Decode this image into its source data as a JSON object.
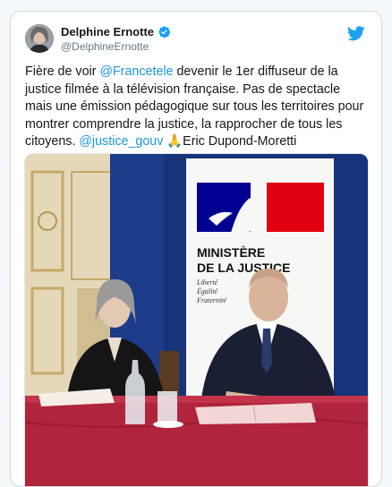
{
  "author": {
    "name": "Delphine Ernotte",
    "handle": "@DelphineErnotte",
    "verified": true
  },
  "tweet": {
    "t1": "Fière de voir ",
    "m1": "@Francetele",
    "t2": " devenir le 1er diffuseur de la justice filmée à la télévision française. Pas de spectacle mais une émission pédagogique sur tous les territoires pour montrer comprendre la justice, la rapprocher de tous les citoyens. ",
    "m2": "@justice_gouv",
    "t3": " 🙏Eric Dupond-Moretti"
  },
  "photo": {
    "banner_line1": "MINISTÈRE",
    "banner_line2": "DE LA JUSTICE",
    "motto1": "Liberté",
    "motto2": "Égalité",
    "motto3": "Fraternité"
  },
  "colors": {
    "link": "#1b95e0",
    "twitter_blue": "#1da1f2",
    "marianne_blue": "#000091",
    "marianne_red": "#e1000f",
    "tablecloth": "#b0243c"
  },
  "icons": {
    "brand": "twitter-bird-icon",
    "verified": "verified-badge-icon"
  }
}
